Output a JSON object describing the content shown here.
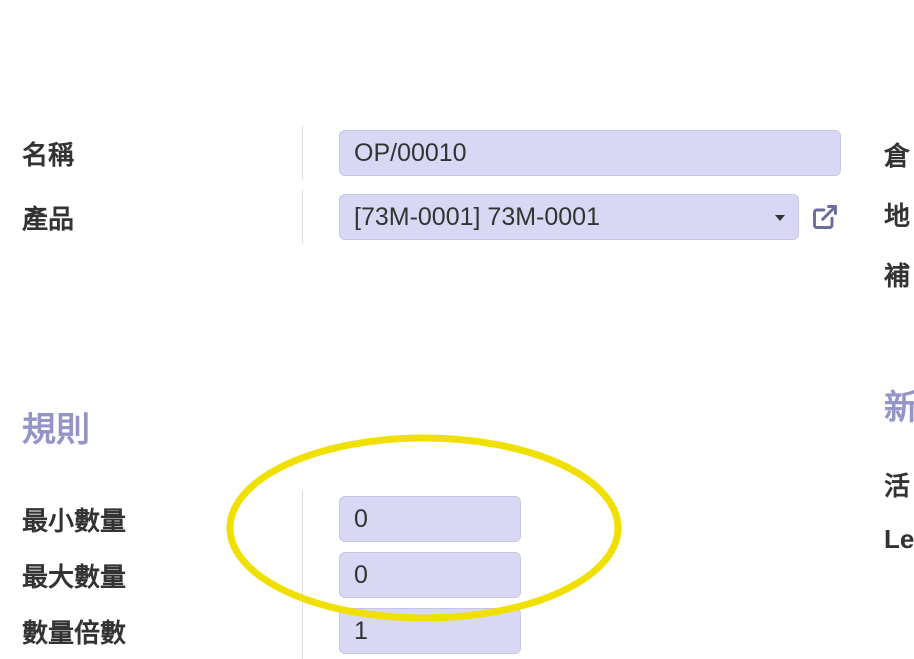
{
  "top": {
    "name_label": "名稱",
    "name_value": "OP/00010",
    "product_label": "產品",
    "product_value": "[73M-0001] 73M-0001"
  },
  "right_partial": {
    "r1": "倉",
    "r2": "地",
    "r3": "補",
    "heading": "新",
    "r4": "活",
    "r5": "Le"
  },
  "rules": {
    "heading": "規則",
    "min_label": "最小數量",
    "min_value": "0",
    "max_label": "最大數量",
    "max_value": "0",
    "mult_label": "數量倍數",
    "mult_value": "1"
  }
}
